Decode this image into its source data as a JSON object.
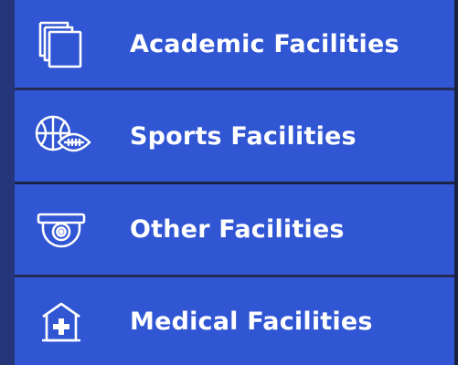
{
  "menu": {
    "items": [
      {
        "label": "Academic Facilities",
        "icon": "stacked-pages-icon"
      },
      {
        "label": "Sports Facilities",
        "icon": "sports-balls-icon"
      },
      {
        "label": "Other Facilities",
        "icon": "security-camera-icon"
      },
      {
        "label": "Medical Facilities",
        "icon": "hospital-icon"
      }
    ]
  },
  "colors": {
    "item_background": "#3056d3",
    "label_text": "#ffffff",
    "left_strip": "#25357a"
  }
}
